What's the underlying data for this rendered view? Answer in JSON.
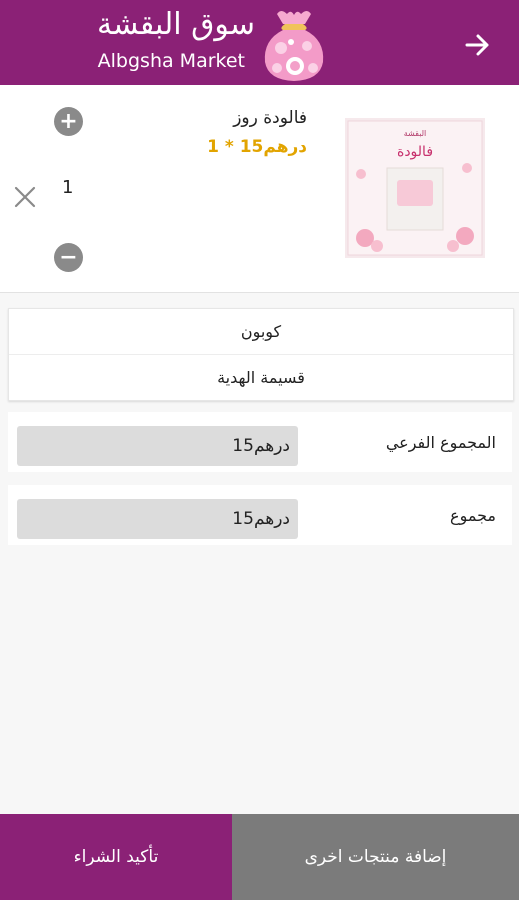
{
  "header": {
    "title_ar": "سوق البقشة",
    "title_en": "Albgsha Market",
    "back_icon": "arrow-right-icon",
    "colors": {
      "brand": "#8b2176"
    }
  },
  "cart": {
    "items": [
      {
        "name": "فالودة روز",
        "price_line": "1 * درهم15",
        "quantity": "1",
        "image_text": "فالودة",
        "image_brand": "البقشة"
      }
    ]
  },
  "coupon": {
    "coupon_label": "كوبون",
    "gift_voucher_label": "قسيمة الهدية"
  },
  "totals": {
    "subtotal_label": "المجموع الفرعي",
    "subtotal_value": "درهم15",
    "total_label": "مجموع",
    "total_value": "درهم15"
  },
  "footer": {
    "confirm_label": "تأكيد الشراء",
    "add_more_label": "إضافة منتجات اخرى",
    "colors": {
      "confirm": "#8b2176",
      "add_more": "#7b7b7b"
    }
  }
}
